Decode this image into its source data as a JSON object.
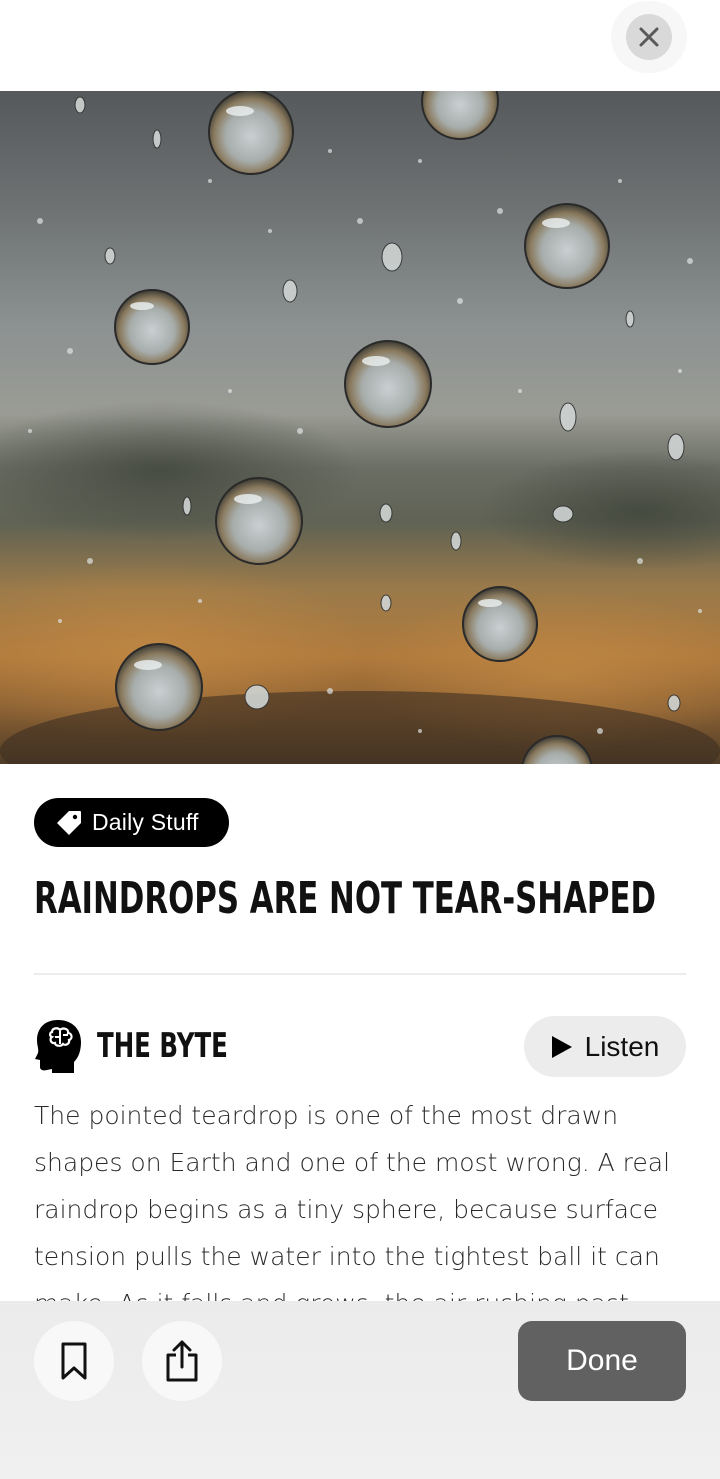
{
  "image": {
    "description": "Raindrops on glass over a blurred landscape"
  },
  "tag": {
    "label": "Daily Stuff",
    "icon": "tag-icon"
  },
  "article": {
    "title": "RAINDROPS ARE NOT TEAR-SHAPED",
    "section_heading": "THE BYTE",
    "section_icon": "brain-head-icon",
    "body": "The pointed teardrop is one of the most drawn shapes on Earth and one of the most wrong. A real raindrop begins as a tiny sphere, because surface tension pulls the water into the tightest ball it can make. As it falls and grows, the air rushing past"
  },
  "listen": {
    "label": "Listen",
    "icon": "play-icon"
  },
  "toolbar": {
    "bookmark_icon": "bookmark-icon",
    "share_icon": "share-icon",
    "done_label": "Done"
  },
  "close": {
    "icon": "close-icon"
  },
  "colors": {
    "tag_bg": "#000000",
    "done_bg": "#616161",
    "listen_bg": "#ececec"
  }
}
